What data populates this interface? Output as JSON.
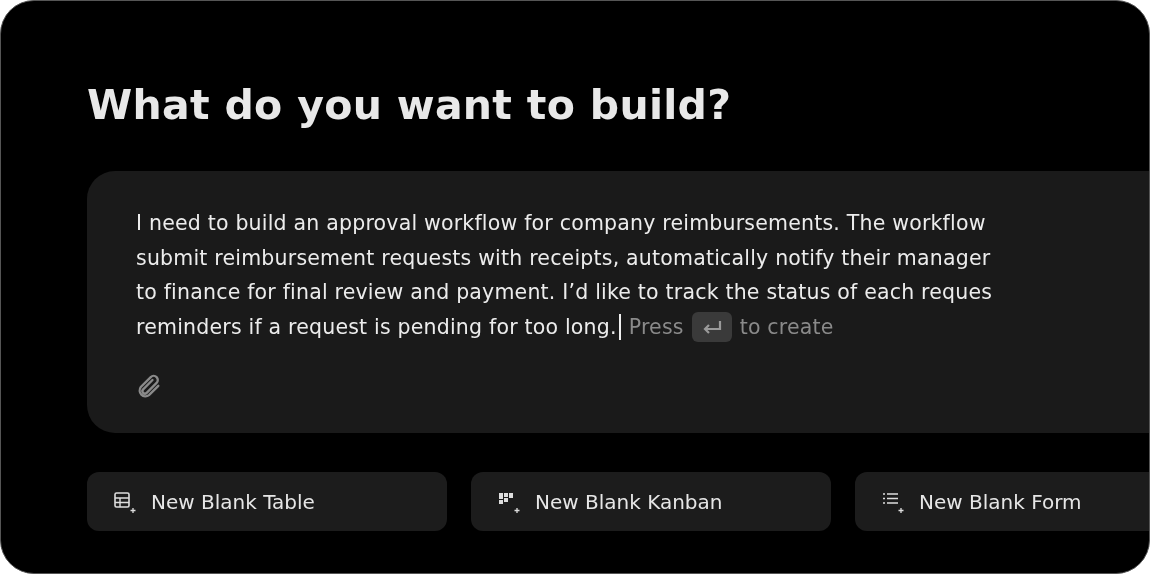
{
  "heading": "What do you want to build?",
  "prompt": {
    "lines": [
      "I need to build an approval workflow for company reimbursements. The workflow",
      "submit reimbursement requests with receipts, automatically notify their manager",
      "to finance for final review and payment. I’d like to track the status of each reques",
      "reminders if a request is pending for too long."
    ],
    "hint_before": "Press",
    "hint_after": "to create"
  },
  "actions": [
    {
      "kind": "table",
      "label": "New Blank Table"
    },
    {
      "kind": "kanban",
      "label": "New Blank Kanban"
    },
    {
      "kind": "form",
      "label": "New Blank Form"
    }
  ]
}
